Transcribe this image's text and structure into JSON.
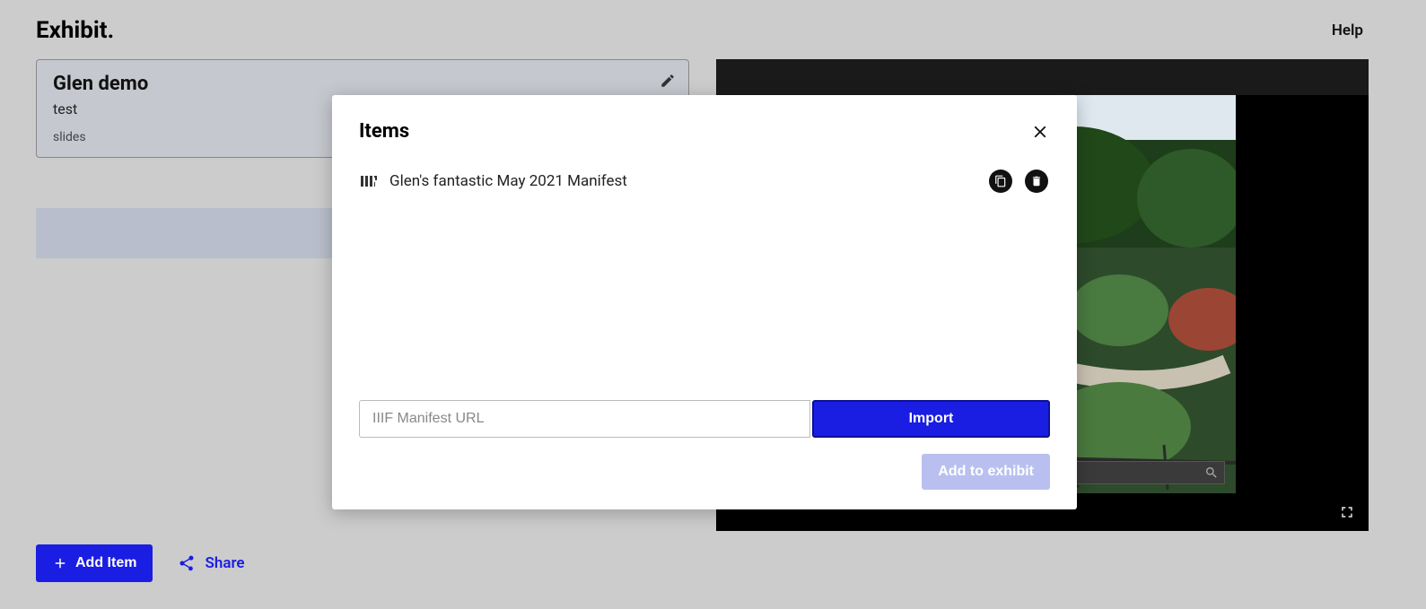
{
  "header": {
    "brand": "Exhibit.",
    "help": "Help"
  },
  "exhibit_card": {
    "title": "Glen demo",
    "description": "test",
    "meta": "slides"
  },
  "actions": {
    "add_item": "Add Item",
    "share": "Share"
  },
  "modal": {
    "title": "Items",
    "item_label": "Glen's fantastic May 2021 Manifest",
    "url_placeholder": "IIIF Manifest URL",
    "import_label": "Import",
    "add_to_exhibit": "Add to exhibit"
  }
}
